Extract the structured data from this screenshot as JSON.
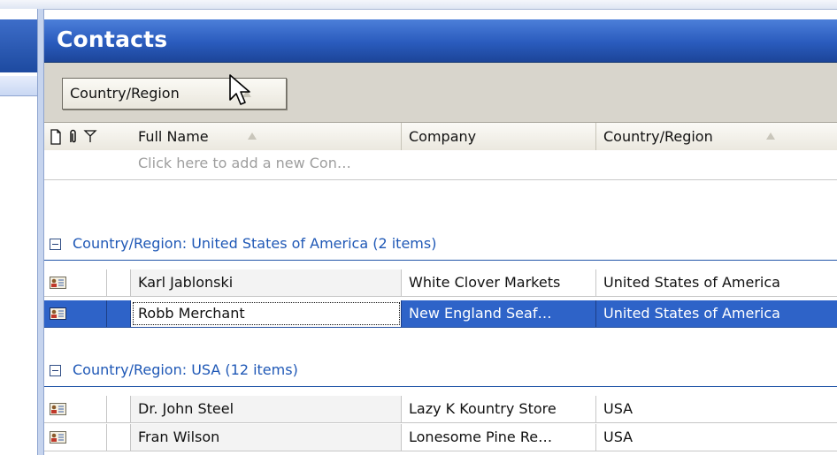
{
  "pane": {
    "title": "Contacts"
  },
  "group_by": {
    "label": "Country/Region"
  },
  "columns": {
    "full_name": "Full Name",
    "company": "Company",
    "country": "Country/Region"
  },
  "new_row": {
    "placeholder": "Click here to add a new Con…"
  },
  "groups": [
    {
      "label": "Country/Region: United States of America (2 items)",
      "rows": [
        {
          "name": "Karl Jablonski",
          "company": "White Clover Markets",
          "country": "United States of America"
        },
        {
          "name": "Robb Merchant",
          "company": "New England Seaf…",
          "country": "United States of America"
        }
      ]
    },
    {
      "label": "Country/Region: USA (12 items)",
      "rows": [
        {
          "name": "Dr. John Steel",
          "company": "Lazy K Kountry Store",
          "country": "USA"
        },
        {
          "name": "Fran Wilson",
          "company": "Lonesome Pine Re…",
          "country": "USA"
        }
      ]
    }
  ],
  "icons": {
    "header": [
      "new-item-icon",
      "attachment-icon",
      "flag-icon"
    ],
    "row": "contact-card-icon",
    "cursor": "mouse-pointer-icon"
  },
  "colors": {
    "header_blue": "#2a5bbd",
    "selection": "#2e63c8",
    "group_text": "#1f58b6"
  }
}
